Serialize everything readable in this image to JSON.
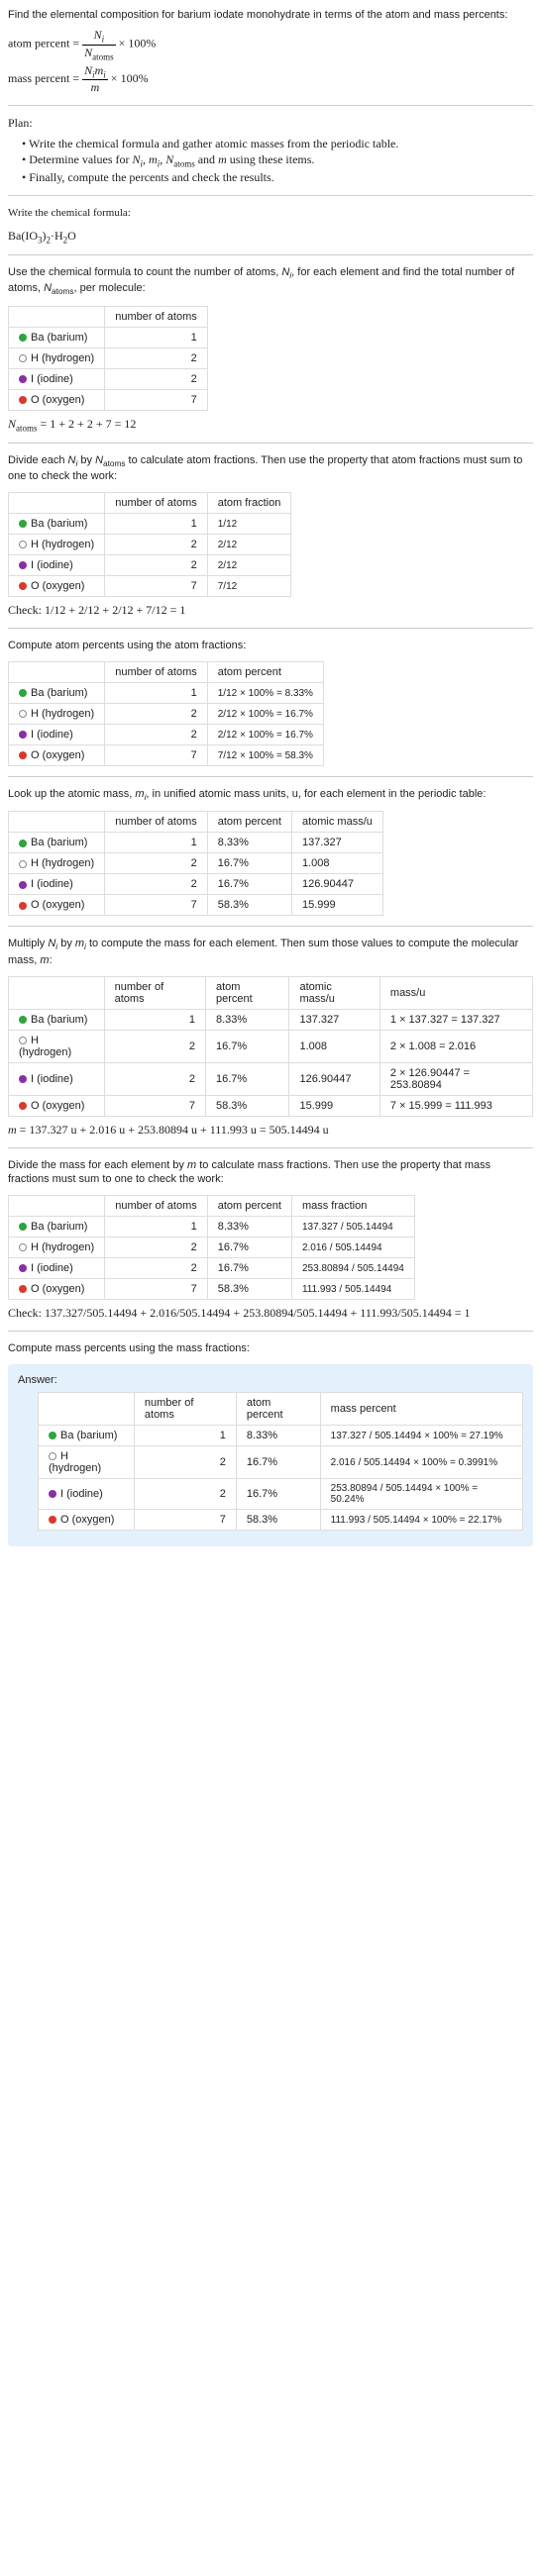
{
  "intro": "Find the elemental composition for barium iodate monohydrate in terms of the atom and mass percents:",
  "atom_percent_formula": "atom percent = N_i / N_atoms × 100%",
  "mass_percent_formula": "mass percent = N_i m_i / m × 100%",
  "plan_label": "Plan:",
  "plan_items": [
    "Write the chemical formula and gather atomic masses from the periodic table.",
    "Determine values for N_i, m_i, N_atoms and m using these items.",
    "Finally, compute the percents and check the results."
  ],
  "write_formula_label": "Write the chemical formula:",
  "chem_formula": "Ba(IO3)2·H2O",
  "count_expl": "Use the chemical formula to count the number of atoms, N_i, for each element and find the total number of atoms, N_atoms, per molecule:",
  "table1_headers": [
    "",
    "number of atoms"
  ],
  "elements": [
    {
      "sym": "Ba",
      "name": "barium",
      "dot": "dot-ba"
    },
    {
      "sym": "H",
      "name": "hydrogen",
      "dot": "dot-h"
    },
    {
      "sym": "I",
      "name": "iodine",
      "dot": "dot-i"
    },
    {
      "sym": "O",
      "name": "oxygen",
      "dot": "dot-o"
    }
  ],
  "n_atoms": [
    "1",
    "2",
    "2",
    "7"
  ],
  "natoms_eq": "N_atoms = 1 + 2 + 2 + 7 = 12",
  "atom_frac_expl": "Divide each N_i by N_atoms to calculate atom fractions. Then use the property that atom fractions must sum to one to check the work:",
  "table2_headers": [
    "",
    "number of atoms",
    "atom fraction"
  ],
  "atom_frac": [
    "1/12",
    "2/12",
    "2/12",
    "7/12"
  ],
  "atom_frac_check": "Check: 1/12 + 2/12 + 2/12 + 7/12 = 1",
  "atom_pct_expl": "Compute atom percents using the atom fractions:",
  "table3_headers": [
    "",
    "number of atoms",
    "atom percent"
  ],
  "atom_pct": [
    "1/12 × 100% = 8.33%",
    "2/12 × 100% = 16.7%",
    "2/12 × 100% = 16.7%",
    "7/12 × 100% = 58.3%"
  ],
  "lookup_expl": "Look up the atomic mass, m_i, in unified atomic mass units, u, for each element in the periodic table:",
  "table4_headers": [
    "",
    "number of atoms",
    "atom percent",
    "atomic mass/u"
  ],
  "atom_pct_short": [
    "8.33%",
    "16.7%",
    "16.7%",
    "58.3%"
  ],
  "atomic_mass": [
    "137.327",
    "1.008",
    "126.90447",
    "15.999"
  ],
  "mass_expl": "Multiply N_i by m_i to compute the mass for each element. Then sum those values to compute the molecular mass, m:",
  "table5_headers": [
    "",
    "number of atoms",
    "atom percent",
    "atomic mass/u",
    "mass/u"
  ],
  "mass_u": [
    "1 × 137.327 = 137.327",
    "2 × 1.008 = 2.016",
    "2 × 126.90447 = 253.80894",
    "7 × 15.999 = 111.993"
  ],
  "m_eq": "m = 137.327 u + 2.016 u + 253.80894 u + 111.993 u = 505.14494 u",
  "mass_frac_expl": "Divide the mass for each element by m to calculate mass fractions. Then use the property that mass fractions must sum to one to check the work:",
  "table6_headers": [
    "",
    "number of atoms",
    "atom percent",
    "mass fraction"
  ],
  "mass_frac": [
    "137.327 / 505.14494",
    "2.016 / 505.14494",
    "253.80894 / 505.14494",
    "111.993 / 505.14494"
  ],
  "mass_frac_check": "Check: 137.327/505.14494 + 2.016/505.14494 + 253.80894/505.14494 + 111.993/505.14494 = 1",
  "mass_pct_expl": "Compute mass percents using the mass fractions:",
  "answer_label": "Answer:",
  "table7_headers": [
    "",
    "number of atoms",
    "atom percent",
    "mass percent"
  ],
  "mass_pct": [
    "137.327 / 505.14494 × 100% = 27.19%",
    "2.016 / 505.14494 × 100% = 0.3991%",
    "253.80894 / 505.14494 × 100% = 50.24%",
    "111.993 / 505.14494 × 100% = 22.17%"
  ]
}
